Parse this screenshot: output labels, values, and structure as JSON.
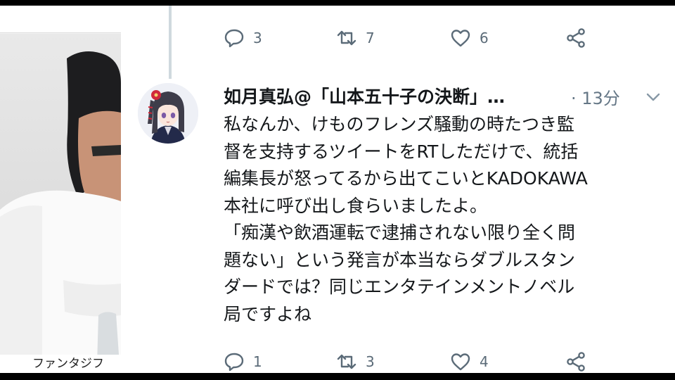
{
  "photo": {
    "caption": "ファンタジフ"
  },
  "previous_tweet": {
    "reply_count": "3",
    "retweet_count": "7",
    "like_count": "6"
  },
  "tweet": {
    "author": "如月真弘@「山本五十子の決断」…",
    "time": "· 13分",
    "lines": [
      "私なんか、けものフレンズ騒動の時たつき監",
      "督を支持するツイートをRTしただけで、統括",
      "編集長が怒ってるから出てこいとKADOKAWA",
      "本社に呼び出し食らいましたよ。",
      "「痴漢や飲酒運転で逮捕されない限り全く問",
      "題ない」という発言が本当ならダブルスタン",
      "ダードでは？同じエンタテインメントノベル",
      "局ですよね"
    ],
    "reply_count": "1",
    "retweet_count": "3",
    "like_count": "4"
  },
  "icons": {
    "reply": "reply-icon",
    "retweet": "retweet-icon",
    "like": "heart-icon",
    "share": "share-icon",
    "menu": "chevron-down-icon"
  },
  "colors": {
    "icon": "#5b6b78",
    "text": "#14171a",
    "meta": "#657786",
    "thread": "#cfd9de"
  }
}
